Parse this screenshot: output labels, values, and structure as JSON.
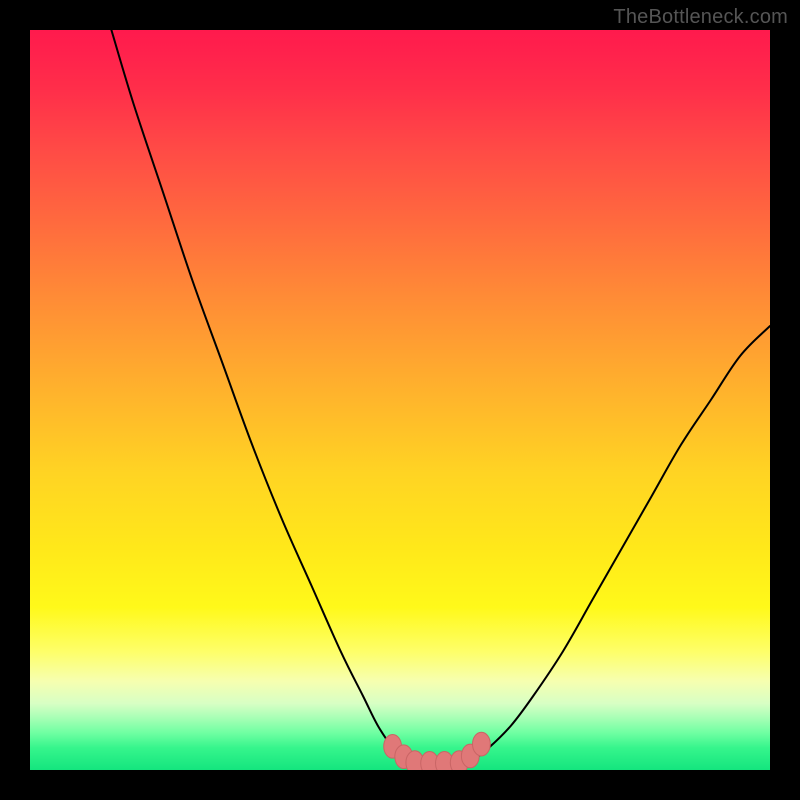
{
  "attribution": "TheBottleneck.com",
  "colors": {
    "frame": "#000000",
    "gradient_top": "#ff1a4d",
    "gradient_mid": "#ffe81a",
    "gradient_bottom": "#14e57e",
    "curve_stroke": "#000000",
    "marker_fill": "#e07878",
    "marker_stroke": "#c96565"
  },
  "chart_data": {
    "type": "line",
    "title": "",
    "xlabel": "",
    "ylabel": "",
    "xlim": [
      0,
      100
    ],
    "ylim": [
      0,
      100
    ],
    "series": [
      {
        "name": "left-curve",
        "x": [
          11,
          14,
          18,
          22,
          26,
          30,
          34,
          38,
          42,
          45,
          47,
          49,
          50,
          51,
          52
        ],
        "y": [
          100,
          90,
          78,
          66,
          55,
          44,
          34,
          25,
          16,
          10,
          6,
          3,
          2,
          1.3,
          1
        ]
      },
      {
        "name": "right-curve",
        "x": [
          58,
          60,
          62,
          65,
          68,
          72,
          76,
          80,
          84,
          88,
          92,
          96,
          100
        ],
        "y": [
          1,
          1.5,
          3,
          6,
          10,
          16,
          23,
          30,
          37,
          44,
          50,
          56,
          60
        ]
      },
      {
        "name": "floor",
        "x": [
          52,
          54,
          56,
          58
        ],
        "y": [
          1,
          0.9,
          0.9,
          1
        ]
      }
    ],
    "markers": [
      {
        "x": 49,
        "y": 3.2
      },
      {
        "x": 50.5,
        "y": 1.8
      },
      {
        "x": 52,
        "y": 1.0
      },
      {
        "x": 54,
        "y": 0.9
      },
      {
        "x": 56,
        "y": 0.9
      },
      {
        "x": 58,
        "y": 1.0
      },
      {
        "x": 59.5,
        "y": 1.9
      },
      {
        "x": 61,
        "y": 3.5
      }
    ],
    "marker_radius_x": 1.2,
    "marker_radius_y": 1.6
  }
}
